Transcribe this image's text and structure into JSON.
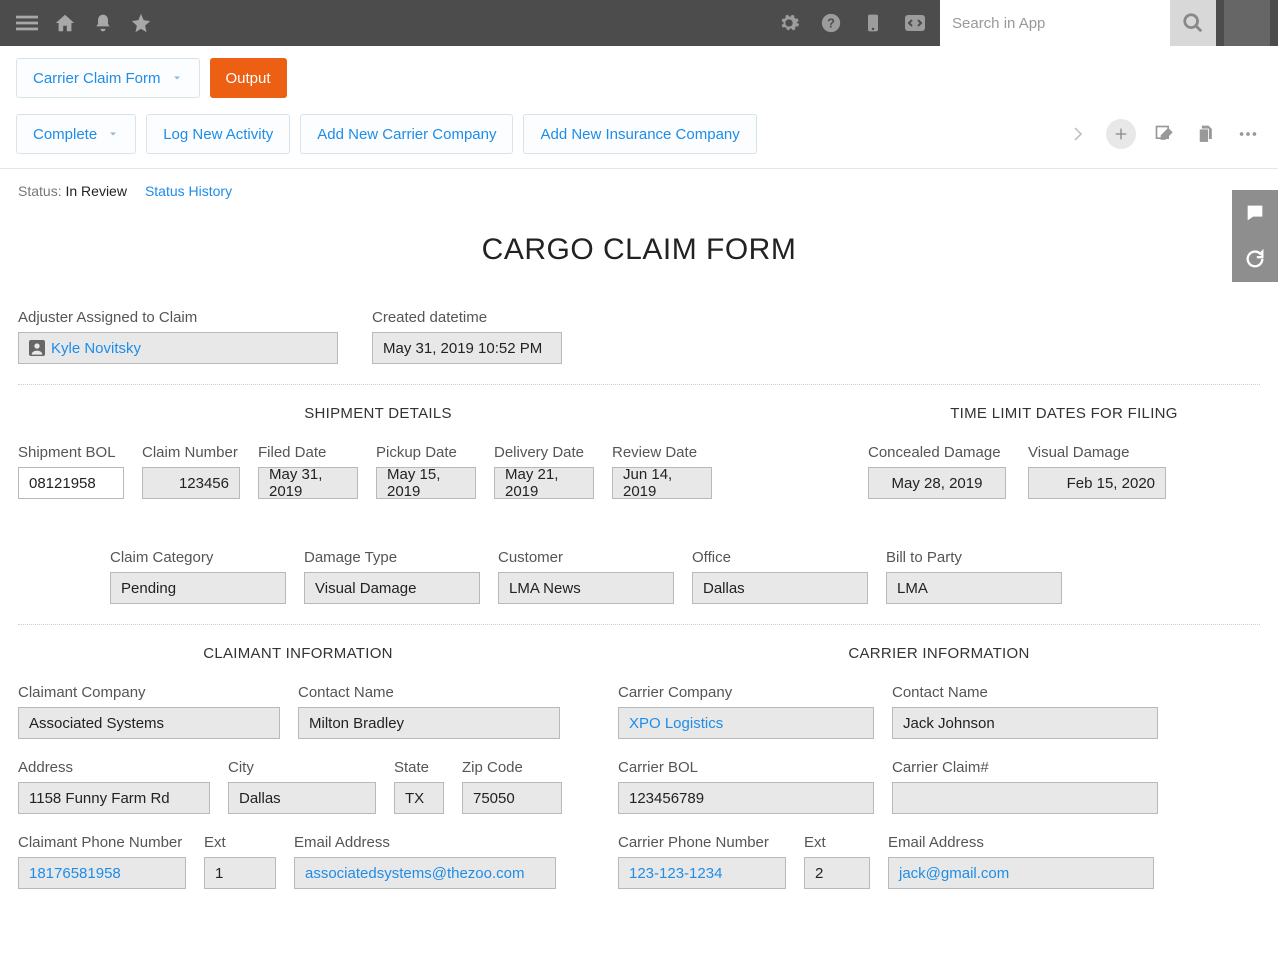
{
  "topbar": {
    "search_placeholder": "Search in App"
  },
  "subbar": {
    "form_selector_label": "Carrier Claim Form",
    "output_label": "Output"
  },
  "actionbar": {
    "complete_label": "Complete",
    "log_activity_label": "Log New Activity",
    "add_carrier_label": "Add New Carrier Company",
    "add_insurance_label": "Add New Insurance Company"
  },
  "status": {
    "label": "Status:",
    "value": "In Review",
    "history_link": "Status History"
  },
  "page_title": "CARGO CLAIM FORM",
  "header_fields": {
    "adjuster_label": "Adjuster Assigned to Claim",
    "adjuster_value": "Kyle Novitsky",
    "created_label": "Created datetime",
    "created_value": "May 31, 2019 10:52 PM"
  },
  "shipment": {
    "title": "SHIPMENT DETAILS",
    "bol_label": "Shipment BOL",
    "bol_value": "08121958",
    "claim_number_label": "Claim Number",
    "claim_number_value": "123456",
    "filed_date_label": "Filed Date",
    "filed_date_value": "May 31, 2019",
    "pickup_date_label": "Pickup Date",
    "pickup_date_value": "May 15, 2019",
    "delivery_date_label": "Delivery Date",
    "delivery_date_value": "May 21, 2019",
    "review_date_label": "Review Date",
    "review_date_value": "Jun 14, 2019"
  },
  "filing_limits": {
    "title": "TIME LIMIT DATES FOR FILING",
    "concealed_label": "Concealed Damage",
    "concealed_value": "May 28, 2019",
    "visual_label": "Visual Damage",
    "visual_value": "Feb 15, 2020"
  },
  "category_row": {
    "claim_category_label": "Claim Category",
    "claim_category_value": "Pending",
    "damage_type_label": "Damage Type",
    "damage_type_value": "Visual Damage",
    "customer_label": "Customer",
    "customer_value": "LMA News",
    "office_label": "Office",
    "office_value": "Dallas",
    "bill_to_label": "Bill to Party",
    "bill_to_value": "LMA"
  },
  "claimant": {
    "title": "CLAIMANT INFORMATION",
    "company_label": "Claimant Company",
    "company_value": "Associated Systems",
    "contact_label": "Contact Name",
    "contact_value": "Milton Bradley",
    "address_label": "Address",
    "address_value": "1158 Funny Farm Rd",
    "city_label": "City",
    "city_value": "Dallas",
    "state_label": "State",
    "state_value": "TX",
    "zip_label": "Zip Code",
    "zip_value": "75050",
    "phone_label": "Claimant Phone Number",
    "phone_value": "18176581958",
    "ext_label": "Ext",
    "ext_value": "1",
    "email_label": "Email Address",
    "email_value": "associatedsystems@thezoo.com"
  },
  "carrier": {
    "title": "CARRIER INFORMATION",
    "company_label": "Carrier Company",
    "company_value": "XPO Logistics",
    "contact_label": "Contact Name",
    "contact_value": "Jack Johnson",
    "bol_label": "Carrier BOL",
    "bol_value": "123456789",
    "claim_label": "Carrier Claim#",
    "claim_value": "",
    "phone_label": "Carrier Phone Number",
    "phone_value": "123-123-1234",
    "ext_label": "Ext",
    "ext_value": "2",
    "email_label": "Email Address",
    "email_value": "jack@gmail.com"
  }
}
